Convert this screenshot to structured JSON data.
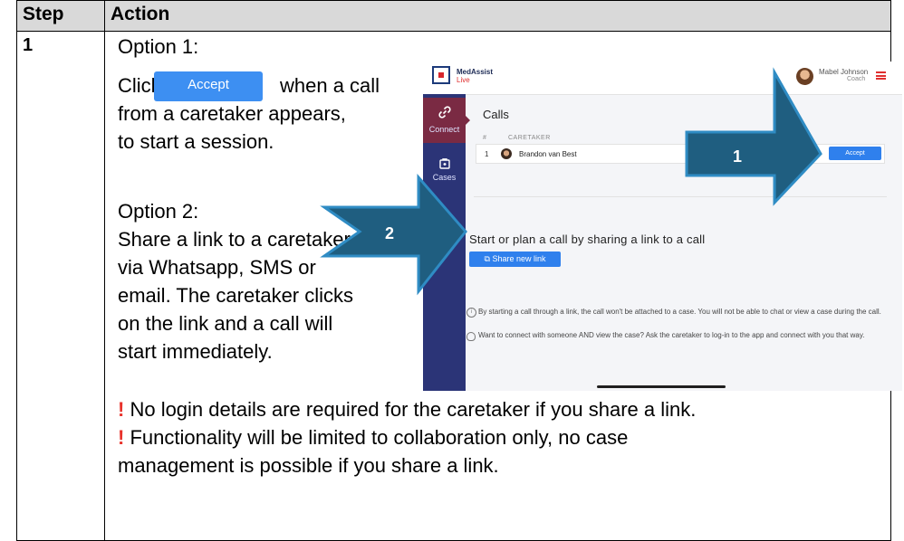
{
  "table": {
    "header_step": "Step",
    "header_action": "Action",
    "step_number": "1"
  },
  "action": {
    "option1_title": "Option 1:",
    "option1_click": "Click",
    "option1_accept_button": "Accept",
    "option1_line1_rest": "when a call",
    "option1_line2": "from a caretaker appears,",
    "option1_line3": "to start a session.",
    "option2_title": "Option 2:",
    "option2_lines": [
      "Share a link to a caretaker",
      "via Whatsapp, SMS or",
      "email. The caretaker clicks",
      "on the link and a call will",
      "start immediately."
    ],
    "warning_mark": "!",
    "warning1": "No login details are required for the caretaker if you share a link.",
    "warning2_line1": "Functionality will be limited to collaboration only, no case",
    "warning2_line2": "management is possible if you share a link."
  },
  "screenshot": {
    "app_name": "MedAssist",
    "app_sub": "Live",
    "user_name": "Mabel Johnson",
    "user_role": "Coach",
    "sidebar": [
      {
        "label": "Connect",
        "icon": "link-icon"
      },
      {
        "label": "Cases",
        "icon": "cases-icon"
      }
    ],
    "calls_title": "Calls",
    "col_hash": "#",
    "col_caretaker": "CARETAKER",
    "row_num": "1",
    "row_name": "Brandon van Best",
    "row_accept": "Accept",
    "plan_title": "Start or plan a call by sharing a link to a call",
    "share_button": "Share new link",
    "note1": "By starting a call through a link, the call won't be attached to a case. You will not be able to chat or view a case during the call.",
    "note2": "Want to connect with someone AND view the case? Ask the caretaker to log-in to the app and connect with you that way.",
    "arrow1_label": "1",
    "arrow2_label": "2"
  },
  "colors": {
    "accent_blue": "#3d8ff2",
    "sidebar": "#2b3477",
    "sidebar_active": "#7a2a43",
    "arrow_fill": "#1f5e80",
    "arrow_stroke": "#2f8cc4",
    "warning": "#e8322b"
  }
}
